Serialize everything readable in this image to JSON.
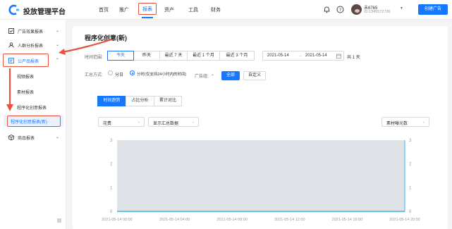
{
  "header": {
    "brand": "投放管理平台",
    "nav": [
      "首页",
      "推广",
      "报表",
      "资产",
      "工具",
      "财务"
    ],
    "user_name": "未6765",
    "user_id": "ID:1345572736",
    "create_button": "创建广告"
  },
  "sidebar": {
    "items": [
      {
        "label": "广告效果报表",
        "icon": "report-icon",
        "chevron": "⌄"
      },
      {
        "label": "人群分析报表",
        "icon": "people-icon",
        "chevron": "⌄"
      },
      {
        "label": "公产品报表",
        "icon": "product-report-icon",
        "chevron": "⌃"
      },
      {
        "label": "商品报表",
        "icon": "cube-icon",
        "chevron": "⌄"
      }
    ],
    "sub_items": [
      "视频报表",
      "素材报表",
      "程序化创意报表",
      "程序化创意报表(新)"
    ]
  },
  "main": {
    "title": "程序化创意(新)",
    "time_range_label": "时间范围:",
    "time_buttons": [
      "今天",
      "昨天",
      "最近 7 天",
      "最近 1 个月",
      "最近 3 个月"
    ],
    "date_start": "2021-05-14",
    "date_arrow": "→",
    "date_end": "2021-05-14",
    "day_count": "共 1 天",
    "summary_label": "汇总方式:",
    "radio_day": "分日",
    "radio_hour": "分时(仅支持24小时内的时间)",
    "ad_group_label": "广告组:",
    "ad_group_caret": "⌄",
    "btn_all": "全部",
    "btn_custom": "自定义",
    "tabs": [
      "时间趋势",
      "占比分析",
      "累计对比"
    ],
    "select_metric": "花费",
    "select_display": "显示汇总数据",
    "select_right": "素材曝光数",
    "select_caret": "⌄"
  },
  "chart_data": {
    "type": "line",
    "title": "",
    "xlabel": "",
    "ylabel": "",
    "ylim": [
      0,
      3
    ],
    "y_ticks_left": [
      "3",
      "2",
      "1",
      "0"
    ],
    "y_ticks_right": [
      "3",
      "2",
      "1",
      "0"
    ],
    "x": [
      "2021-05-14 00:00",
      "2021-05-14 04:00",
      "2021-05-14 08:00",
      "2021-05-14 12:00",
      "2021-05-14 16:00",
      "2021-05-14 20:00"
    ],
    "series": [
      {
        "values": [
          0,
          0,
          0,
          0,
          0,
          0
        ],
        "color": "#35b6e8"
      }
    ]
  },
  "colors": {
    "accent": "#1677ff",
    "highlight": "#e5533d",
    "series": "#35b6e8"
  }
}
